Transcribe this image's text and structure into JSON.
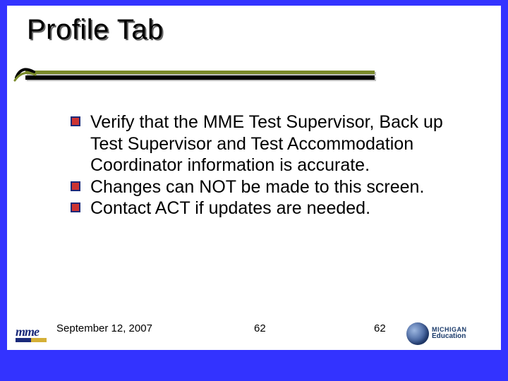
{
  "title": "Profile Tab",
  "bullets": [
    "Verify that the MME Test Supervisor, Back up Test Supervisor and Test Accommodation Coordinator information is accurate.",
    "Changes can NOT be made to this screen.",
    "Contact ACT if updates are needed."
  ],
  "footer": {
    "date": "September 12, 2007",
    "center_page": "62",
    "right_page": "62"
  },
  "logos": {
    "mme": "mme",
    "michigan_top": "MICHIGAN",
    "michigan_bottom": "Education"
  }
}
